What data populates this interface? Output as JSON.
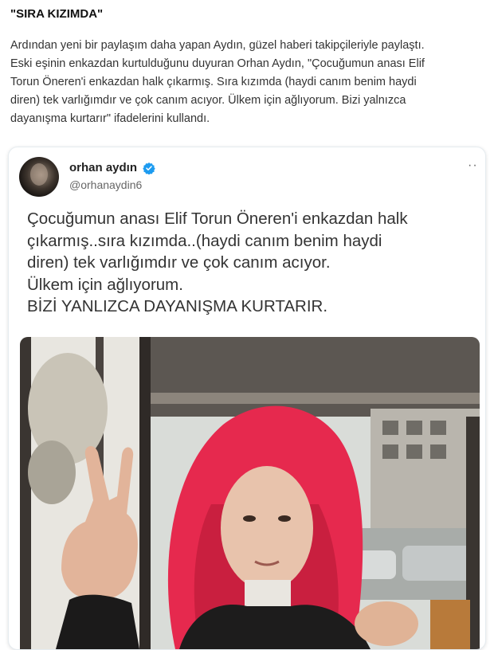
{
  "article": {
    "headline": "\"SIRA KIZIMDA\"",
    "paragraph_lines": [
      "Ardından yeni bir paylaşım daha yapan Aydın, güzel haberi takipçileriyle paylaştı.",
      "Eski eşinin enkazdan kurtulduğunu duyuran Orhan Aydın, \"Çocuğumun anası Elif",
      "Torun Öneren'i enkazdan halk çıkarmış. Sıra kızımda (haydi canım benim haydi",
      "diren) tek varlığımdır ve çok canım acıyor. Ülkem için ağlıyorum. Bizi yalnızca",
      "dayanışma kurtarır\" ifadelerini kullandı."
    ]
  },
  "tweet": {
    "display_name": "orhan aydın",
    "handle": "@orhanaydin6",
    "more_label": "··",
    "verified_color": "#1d9bf0",
    "text_lines": [
      "Çocuğumun anası Elif Torun Öneren'i enkazdan halk",
      "çıkarmış..sıra kızımda..(haydi canım benim haydi",
      "diren) tek varlığımdır ve çok canım acıyor.",
      "Ülkem için ağlıyorum.",
      "BİZİ YANLIZCA DAYANIŞMA KURTARIR."
    ],
    "photo_icon": "photo-of-woman-with-red-hair-making-peace-sign"
  }
}
